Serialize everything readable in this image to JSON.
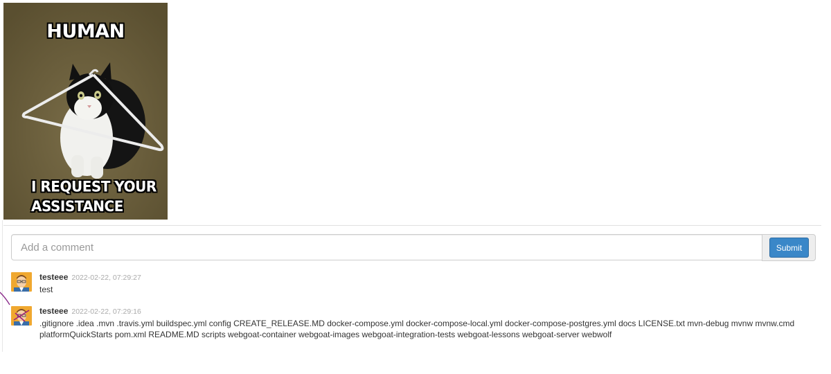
{
  "meme": {
    "top_text": "HUMAN",
    "bottom_line1": "I REQUEST YOUR",
    "bottom_line2": "ASSISTANCE"
  },
  "comment_form": {
    "placeholder": "Add a comment",
    "submit_label": "Submit"
  },
  "comments": [
    {
      "user": "testeee",
      "time": "2022-02-22, 07:29:27",
      "text": "test"
    },
    {
      "user": "testeee",
      "time": "2022-02-22, 07:29:16",
      "text": ".gitignore .idea .mvn .travis.yml buildspec.yml config CREATE_RELEASE.MD docker-compose.yml docker-compose-local.yml docker-compose-postgres.yml docs LICENSE.txt mvn-debug mvnw mvnw.cmd platformQuickStarts pom.xml README.MD scripts webgoat-container webgoat-images webgoat-integration-tests webgoat-lessons webgoat-server webwolf"
    }
  ],
  "colors": {
    "primary_button": "#3a87c8",
    "timestamp": "#aaaaaa"
  }
}
